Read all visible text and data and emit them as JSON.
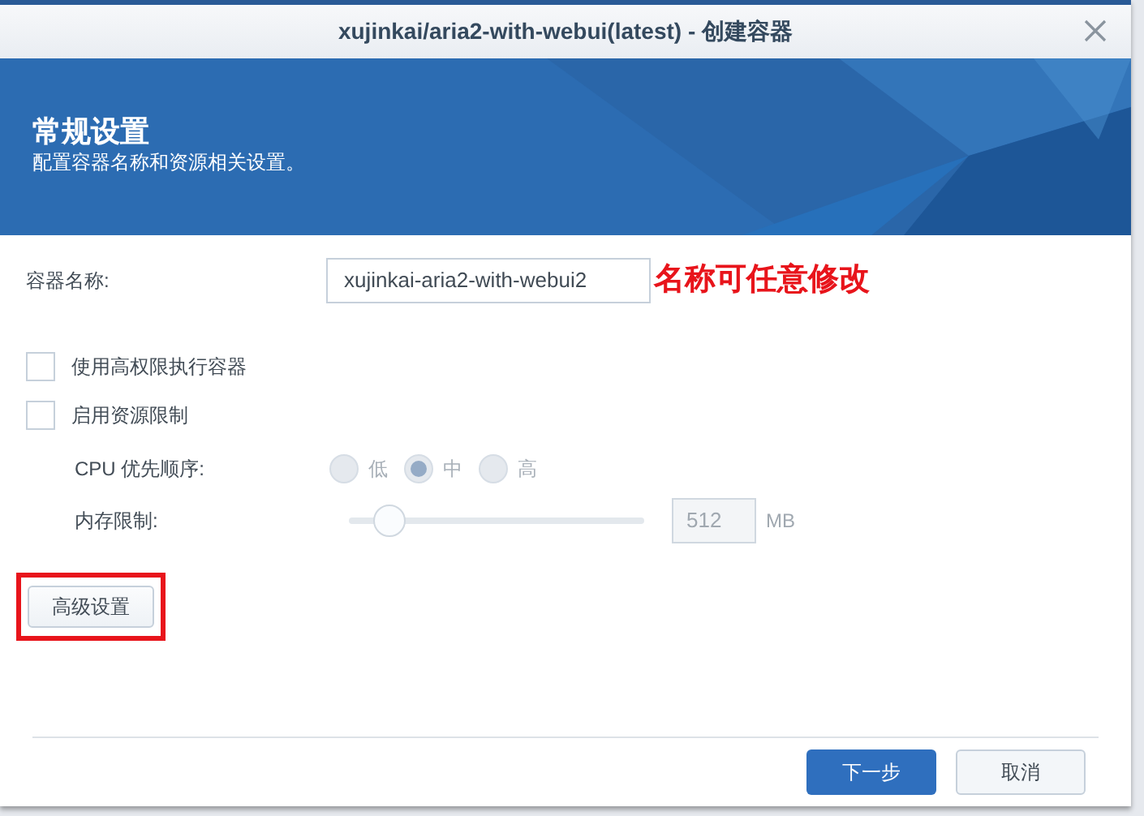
{
  "window": {
    "title": "xujinkai/aria2-with-webui(latest) - 创建容器"
  },
  "header": {
    "title": "常规设置",
    "subtitle": "配置容器名称和资源相关设置。"
  },
  "name_field": {
    "label": "容器名称:",
    "value": "xujinkai-aria2-with-webui2",
    "annotation": "名称可任意修改"
  },
  "checkboxes": [
    {
      "label": "使用高权限执行容器",
      "checked": false
    },
    {
      "label": "启用资源限制",
      "checked": false
    }
  ],
  "cpu_priority": {
    "label": "CPU 优先顺序:",
    "disabled": true,
    "options": [
      {
        "label": "低",
        "selected": false
      },
      {
        "label": "中",
        "selected": true
      },
      {
        "label": "高",
        "selected": false
      }
    ]
  },
  "memory_limit": {
    "label": "内存限制:",
    "level": 0.14,
    "value": "512",
    "unit": "MB"
  },
  "advanced_button": {
    "label": "高级设置",
    "highlighted": true
  },
  "footer_buttons": [
    {
      "label": "下一步",
      "kind": "primary"
    },
    {
      "label": "取消",
      "kind": "secondary"
    }
  ]
}
